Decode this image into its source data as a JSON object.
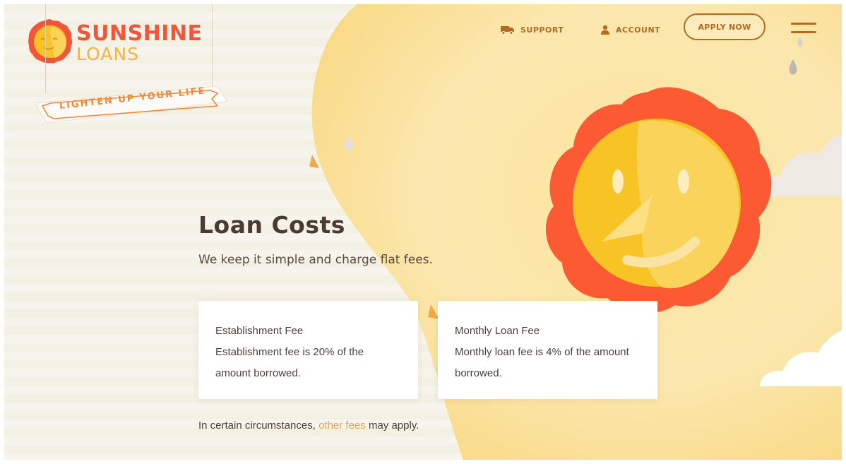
{
  "brand": {
    "name_line1": "SUNSHINE",
    "name_line2": "LOANS",
    "tagline": "LIGHTEN UP YOUR LIFE"
  },
  "nav": {
    "support_label": "SUPPORT",
    "account_label": "ACCOUNT",
    "apply_label": "APPLY NOW"
  },
  "content": {
    "title": "Loan Costs",
    "subtitle": "We keep it simple and charge flat fees.",
    "cards": [
      {
        "title": "Establishment Fee",
        "description": "Establishment fee is 20% of the amount borrowed."
      },
      {
        "title": "Monthly Loan Fee",
        "description": "Monthly loan fee is 4% of the amount borrowed."
      }
    ],
    "footnote_prefix": "In certain circumstances, ",
    "footnote_link": "other fees",
    "footnote_suffix": " may apply."
  },
  "colors": {
    "brand_red": "#f2563a",
    "brand_yellow": "#f4b23d",
    "nav_brown": "#b5691f",
    "link_orange": "#f2a23a",
    "background": "#f3f0e4"
  },
  "icons": {
    "support": "truck-icon",
    "account": "person-icon",
    "menu": "hamburger-menu-icon"
  }
}
